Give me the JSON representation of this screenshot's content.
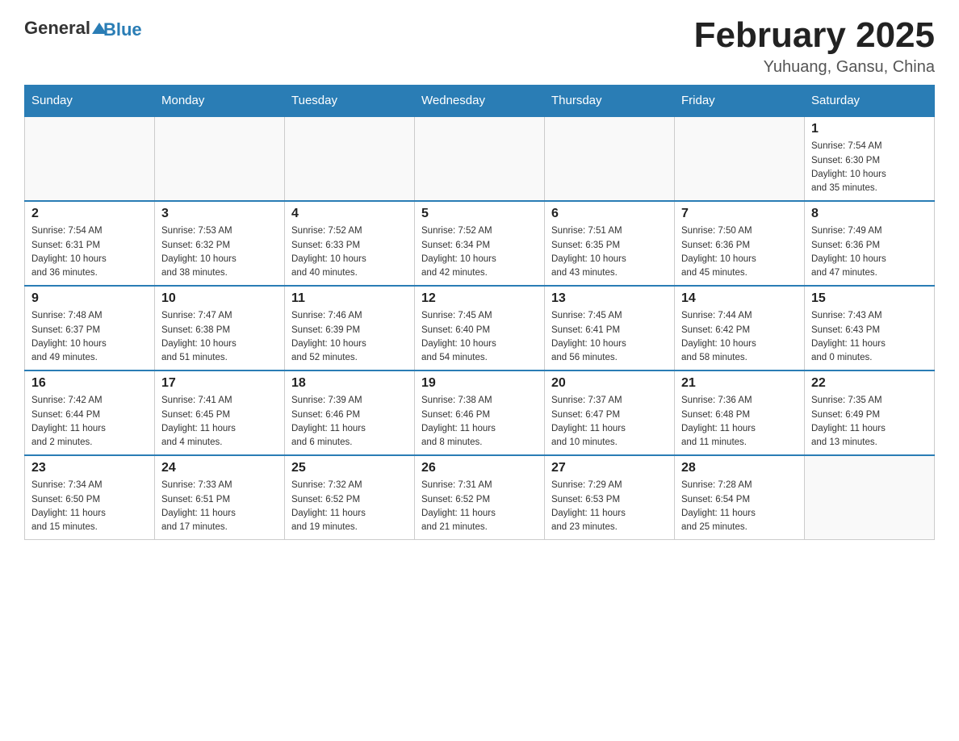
{
  "logo": {
    "general": "General",
    "triangle_icon": "▲",
    "blue": "Blue"
  },
  "title": "February 2025",
  "location": "Yuhuang, Gansu, China",
  "days_of_week": [
    "Sunday",
    "Monday",
    "Tuesday",
    "Wednesday",
    "Thursday",
    "Friday",
    "Saturday"
  ],
  "weeks": [
    [
      {
        "day": "",
        "info": ""
      },
      {
        "day": "",
        "info": ""
      },
      {
        "day": "",
        "info": ""
      },
      {
        "day": "",
        "info": ""
      },
      {
        "day": "",
        "info": ""
      },
      {
        "day": "",
        "info": ""
      },
      {
        "day": "1",
        "info": "Sunrise: 7:54 AM\nSunset: 6:30 PM\nDaylight: 10 hours\nand 35 minutes."
      }
    ],
    [
      {
        "day": "2",
        "info": "Sunrise: 7:54 AM\nSunset: 6:31 PM\nDaylight: 10 hours\nand 36 minutes."
      },
      {
        "day": "3",
        "info": "Sunrise: 7:53 AM\nSunset: 6:32 PM\nDaylight: 10 hours\nand 38 minutes."
      },
      {
        "day": "4",
        "info": "Sunrise: 7:52 AM\nSunset: 6:33 PM\nDaylight: 10 hours\nand 40 minutes."
      },
      {
        "day": "5",
        "info": "Sunrise: 7:52 AM\nSunset: 6:34 PM\nDaylight: 10 hours\nand 42 minutes."
      },
      {
        "day": "6",
        "info": "Sunrise: 7:51 AM\nSunset: 6:35 PM\nDaylight: 10 hours\nand 43 minutes."
      },
      {
        "day": "7",
        "info": "Sunrise: 7:50 AM\nSunset: 6:36 PM\nDaylight: 10 hours\nand 45 minutes."
      },
      {
        "day": "8",
        "info": "Sunrise: 7:49 AM\nSunset: 6:36 PM\nDaylight: 10 hours\nand 47 minutes."
      }
    ],
    [
      {
        "day": "9",
        "info": "Sunrise: 7:48 AM\nSunset: 6:37 PM\nDaylight: 10 hours\nand 49 minutes."
      },
      {
        "day": "10",
        "info": "Sunrise: 7:47 AM\nSunset: 6:38 PM\nDaylight: 10 hours\nand 51 minutes."
      },
      {
        "day": "11",
        "info": "Sunrise: 7:46 AM\nSunset: 6:39 PM\nDaylight: 10 hours\nand 52 minutes."
      },
      {
        "day": "12",
        "info": "Sunrise: 7:45 AM\nSunset: 6:40 PM\nDaylight: 10 hours\nand 54 minutes."
      },
      {
        "day": "13",
        "info": "Sunrise: 7:45 AM\nSunset: 6:41 PM\nDaylight: 10 hours\nand 56 minutes."
      },
      {
        "day": "14",
        "info": "Sunrise: 7:44 AM\nSunset: 6:42 PM\nDaylight: 10 hours\nand 58 minutes."
      },
      {
        "day": "15",
        "info": "Sunrise: 7:43 AM\nSunset: 6:43 PM\nDaylight: 11 hours\nand 0 minutes."
      }
    ],
    [
      {
        "day": "16",
        "info": "Sunrise: 7:42 AM\nSunset: 6:44 PM\nDaylight: 11 hours\nand 2 minutes."
      },
      {
        "day": "17",
        "info": "Sunrise: 7:41 AM\nSunset: 6:45 PM\nDaylight: 11 hours\nand 4 minutes."
      },
      {
        "day": "18",
        "info": "Sunrise: 7:39 AM\nSunset: 6:46 PM\nDaylight: 11 hours\nand 6 minutes."
      },
      {
        "day": "19",
        "info": "Sunrise: 7:38 AM\nSunset: 6:46 PM\nDaylight: 11 hours\nand 8 minutes."
      },
      {
        "day": "20",
        "info": "Sunrise: 7:37 AM\nSunset: 6:47 PM\nDaylight: 11 hours\nand 10 minutes."
      },
      {
        "day": "21",
        "info": "Sunrise: 7:36 AM\nSunset: 6:48 PM\nDaylight: 11 hours\nand 11 minutes."
      },
      {
        "day": "22",
        "info": "Sunrise: 7:35 AM\nSunset: 6:49 PM\nDaylight: 11 hours\nand 13 minutes."
      }
    ],
    [
      {
        "day": "23",
        "info": "Sunrise: 7:34 AM\nSunset: 6:50 PM\nDaylight: 11 hours\nand 15 minutes."
      },
      {
        "day": "24",
        "info": "Sunrise: 7:33 AM\nSunset: 6:51 PM\nDaylight: 11 hours\nand 17 minutes."
      },
      {
        "day": "25",
        "info": "Sunrise: 7:32 AM\nSunset: 6:52 PM\nDaylight: 11 hours\nand 19 minutes."
      },
      {
        "day": "26",
        "info": "Sunrise: 7:31 AM\nSunset: 6:52 PM\nDaylight: 11 hours\nand 21 minutes."
      },
      {
        "day": "27",
        "info": "Sunrise: 7:29 AM\nSunset: 6:53 PM\nDaylight: 11 hours\nand 23 minutes."
      },
      {
        "day": "28",
        "info": "Sunrise: 7:28 AM\nSunset: 6:54 PM\nDaylight: 11 hours\nand 25 minutes."
      },
      {
        "day": "",
        "info": ""
      }
    ]
  ]
}
